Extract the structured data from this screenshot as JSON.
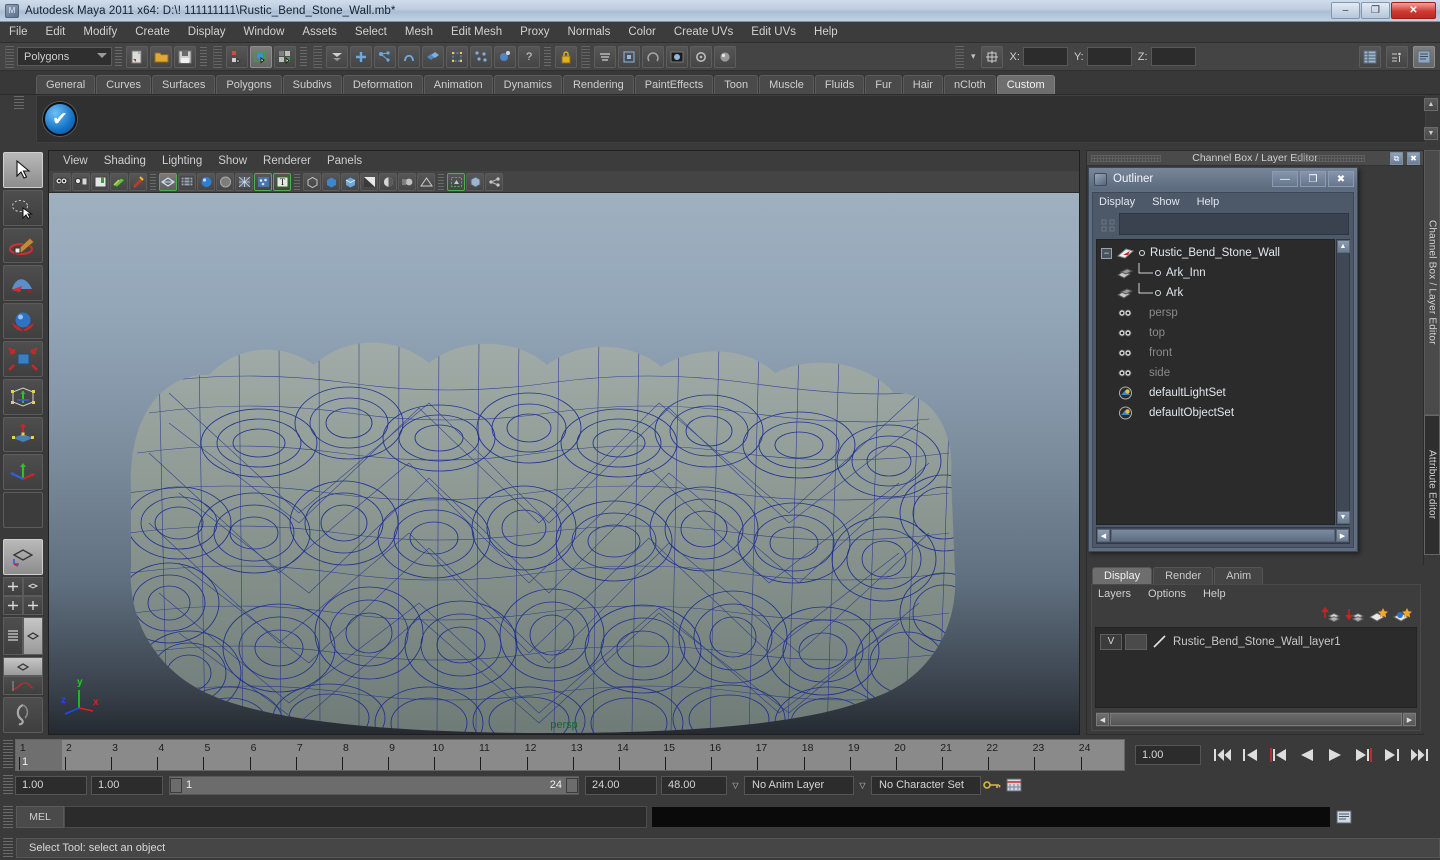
{
  "window": {
    "title": "Autodesk Maya 2011 x64: D:\\! 111111111\\Rustic_Bend_Stone_Wall.mb*",
    "icon": "maya-app-icon",
    "minimize": "–",
    "restore": "❐",
    "close": "✕"
  },
  "menubar": {
    "items": [
      "File",
      "Edit",
      "Modify",
      "Create",
      "Display",
      "Window",
      "Assets",
      "Select",
      "Mesh",
      "Edit Mesh",
      "Proxy",
      "Normals",
      "Color",
      "Create UVs",
      "Edit UVs",
      "Help"
    ]
  },
  "toolbar": {
    "selection_mode": "Polygons",
    "coord_labels": {
      "x": "X:",
      "y": "Y:",
      "z": "Z:"
    },
    "coord_values": {
      "x": "",
      "y": "",
      "z": ""
    },
    "icons": [
      "new-scene-icon",
      "open-scene-icon",
      "save-scene-icon",
      "select-by-hierarchy-icon",
      "select-by-object-icon",
      "select-by-component-icon",
      "snap-to-grid-icon",
      "snap-to-curve-icon",
      "snap-to-point-icon",
      "snap-to-plane-icon",
      "snap-to-view-plane-icon",
      "make-live-icon",
      "construction-history-icon",
      "help-icon",
      "lock-icon"
    ],
    "right_icons": [
      "show-channel-box-icon",
      "show-attribute-editor-icon",
      "show-tool-settings-icon"
    ]
  },
  "shelf": {
    "tabs": [
      "General",
      "Curves",
      "Surfaces",
      "Polygons",
      "Subdivs",
      "Deformation",
      "Animation",
      "Dynamics",
      "Rendering",
      "PaintEffects",
      "Toon",
      "Muscle",
      "Fluids",
      "Fur",
      "Hair",
      "nCloth",
      "Custom"
    ],
    "active_tab": "Custom",
    "items": [
      {
        "icon": "blue-checkmark-icon",
        "glyph": "✔"
      }
    ]
  },
  "toolbox": {
    "items": [
      {
        "name": "select-tool",
        "active": true
      },
      {
        "name": "lasso-select-tool",
        "active": false
      },
      {
        "name": "paint-select-tool",
        "active": false
      },
      {
        "name": "soft-modification-tool",
        "active": false
      },
      {
        "name": "move-tool",
        "active": false
      },
      {
        "name": "rotate-tool",
        "active": false
      },
      {
        "name": "scale-tool",
        "active": false
      },
      {
        "name": "universal-manipulator-tool",
        "active": false
      },
      {
        "name": "show-manipulator-tool",
        "active": false
      },
      {
        "name": "last-tool-used",
        "active": false
      },
      {
        "name": "single-perspective-view-layout",
        "active": true
      },
      {
        "name": "four-view-layout",
        "active": false
      },
      {
        "name": "outliner-persp-layout",
        "active": false
      },
      {
        "name": "persp-graph-layout",
        "active": false
      },
      {
        "name": "paint-effects-layout",
        "active": false
      }
    ]
  },
  "viewport": {
    "menus": [
      "View",
      "Shading",
      "Lighting",
      "Show",
      "Renderer",
      "Panels"
    ],
    "camera_label": "persp",
    "axis": {
      "x": "x",
      "y": "y",
      "z": "z",
      "x_color": "#e02020",
      "y_color": "#19d419",
      "z_color": "#2448e8"
    },
    "toolbar_icons": [
      "select-camera-icon",
      "camera-attributes-icon",
      "bookmark-icon",
      "image-plane-icon",
      "grease-pencil-icon",
      "wireframe-shading-icon",
      "smooth-shade-icon",
      "smooth-shade-all-icon",
      "flat-shade-icon",
      "wireframe-on-shaded-icon",
      "xray-icon",
      "xray-joints-icon",
      "texture-icon",
      "lights-off-icon",
      "default-light-icon",
      "all-lights-icon",
      "shadows-icon",
      "occlusion-icon",
      "motion-blur-icon",
      "multisample-icon",
      "isolate-select-icon",
      "panel-share-icon"
    ],
    "background_top": "#9fb0c0",
    "background_bottom": "#252a31",
    "wireframe_color": "#1b2d8f",
    "surface_color": "#8b9690"
  },
  "right_panel": {
    "dock_title": "Channel Box / Layer Editor",
    "vertical_tabs": [
      {
        "label": "Channel Box / Layer Editor",
        "active": false
      },
      {
        "label": "Attribute Editor",
        "active": true
      }
    ]
  },
  "outliner": {
    "title": "Outliner",
    "icon": "outliner-window-icon",
    "window_buttons": {
      "minimize": "—",
      "maximize": "❐",
      "close": "✖"
    },
    "menus": [
      "Display",
      "Show",
      "Help"
    ],
    "search_value": "",
    "tree": [
      {
        "label": "Rustic_Bend_Stone_Wall",
        "indent": 0,
        "expander": "−",
        "icon": "transform-node-icon",
        "dimmed": false,
        "connector": false
      },
      {
        "label": "Ark_Inn",
        "indent": 1,
        "expander": "",
        "icon": "mesh-node-icon",
        "dimmed": false,
        "connector": true
      },
      {
        "label": "Ark",
        "indent": 1,
        "expander": "",
        "icon": "mesh-node-icon",
        "dimmed": false,
        "connector": true
      },
      {
        "label": "persp",
        "indent": 1,
        "expander": "",
        "icon": "camera-node-icon",
        "dimmed": true,
        "connector": false
      },
      {
        "label": "top",
        "indent": 1,
        "expander": "",
        "icon": "camera-node-icon",
        "dimmed": true,
        "connector": false
      },
      {
        "label": "front",
        "indent": 1,
        "expander": "",
        "icon": "camera-node-icon",
        "dimmed": true,
        "connector": false
      },
      {
        "label": "side",
        "indent": 1,
        "expander": "",
        "icon": "camera-node-icon",
        "dimmed": true,
        "connector": false
      },
      {
        "label": "defaultLightSet",
        "indent": 1,
        "expander": "",
        "icon": "set-node-icon",
        "dimmed": false,
        "connector": false
      },
      {
        "label": "defaultObjectSet",
        "indent": 1,
        "expander": "",
        "icon": "set-node-icon",
        "dimmed": false,
        "connector": false
      }
    ]
  },
  "layer_editor": {
    "tabs": [
      "Display",
      "Render",
      "Anim"
    ],
    "active_tab": "Display",
    "menus": [
      "Layers",
      "Options",
      "Help"
    ],
    "icons": [
      "move-layer-up-icon",
      "move-layer-down-icon",
      "new-layer-icon",
      "new-layer-from-selected-icon"
    ],
    "layers": [
      {
        "visibility": "V",
        "display_type": "",
        "name": "Rustic_Bend_Stone_Wall_layer1"
      }
    ]
  },
  "timeline": {
    "ticks": [
      1,
      2,
      3,
      4,
      5,
      6,
      7,
      8,
      9,
      10,
      11,
      12,
      13,
      14,
      15,
      16,
      17,
      18,
      19,
      20,
      21,
      22,
      23,
      24
    ],
    "current_frame_label": "1",
    "current_frame_field": "1.00",
    "playback_buttons": [
      "go-to-start-icon",
      "step-back-keyframe-icon",
      "step-back-frame-icon",
      "play-backwards-icon",
      "play-forwards-icon",
      "step-forward-frame-icon",
      "step-forward-keyframe-icon",
      "go-to-end-icon"
    ]
  },
  "range_slider": {
    "start_field": "1.00",
    "range_start_field": "1.00",
    "bar_start": "1",
    "bar_end": "24",
    "range_end_field": "24.00",
    "end_field": "48.00",
    "anim_layer": "No Anim Layer",
    "character_set": "No Character Set",
    "key_icon": "auto-keyframe-icon",
    "prefs_icon": "animation-preferences-icon"
  },
  "command_line": {
    "label": "MEL",
    "input_value": "",
    "output_value": "",
    "script_editor_icon": "script-editor-icon"
  },
  "status_bar": {
    "message": "Select Tool: select an object"
  }
}
